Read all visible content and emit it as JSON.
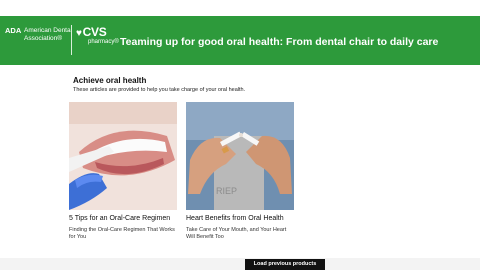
{
  "banner": {
    "ada_mark": "ADA",
    "ada_name": "American Dental Association®",
    "cvs_logo": "CVS",
    "cvs_sub": "pharmacy®",
    "title": "Teaming up for good oral health: From dental chair to daily care"
  },
  "section": {
    "title": "Achieve oral health",
    "subtitle": "These articles are provided to help you take charge of your oral health."
  },
  "cards": [
    {
      "title": "5 Tips for an Oral-Care Regimen",
      "desc": "Finding the Oral-Care Regimen That Works for You"
    },
    {
      "title": "Heart Benefits from Oral Health",
      "desc": "Take Care of Your Mouth, and Your Heart Will Benefit Too"
    }
  ],
  "actions": {
    "load_previous": "Load previous products"
  },
  "colors": {
    "banner": "#2d9a3b",
    "button": "#111111"
  }
}
